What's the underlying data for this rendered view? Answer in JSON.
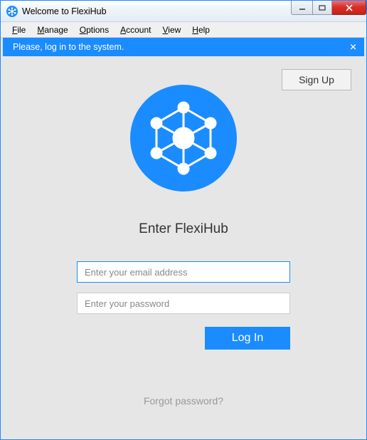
{
  "window": {
    "title": "Welcome to FlexiHub"
  },
  "menubar": {
    "items": [
      {
        "label": "File",
        "accel": "F"
      },
      {
        "label": "Manage",
        "accel": "M"
      },
      {
        "label": "Options",
        "accel": "O"
      },
      {
        "label": "Account",
        "accel": "A"
      },
      {
        "label": "View",
        "accel": "V"
      },
      {
        "label": "Help",
        "accel": "H"
      }
    ]
  },
  "banner": {
    "message": "Please, log in to the system."
  },
  "signup": {
    "label": "Sign Up"
  },
  "login": {
    "heading": "Enter FlexiHub",
    "email_placeholder": "Enter your email address",
    "email_value": "",
    "password_placeholder": "Enter your password",
    "password_value": "",
    "submit_label": "Log In",
    "forgot_label": "Forgot password?"
  },
  "colors": {
    "accent": "#1a8cff"
  }
}
